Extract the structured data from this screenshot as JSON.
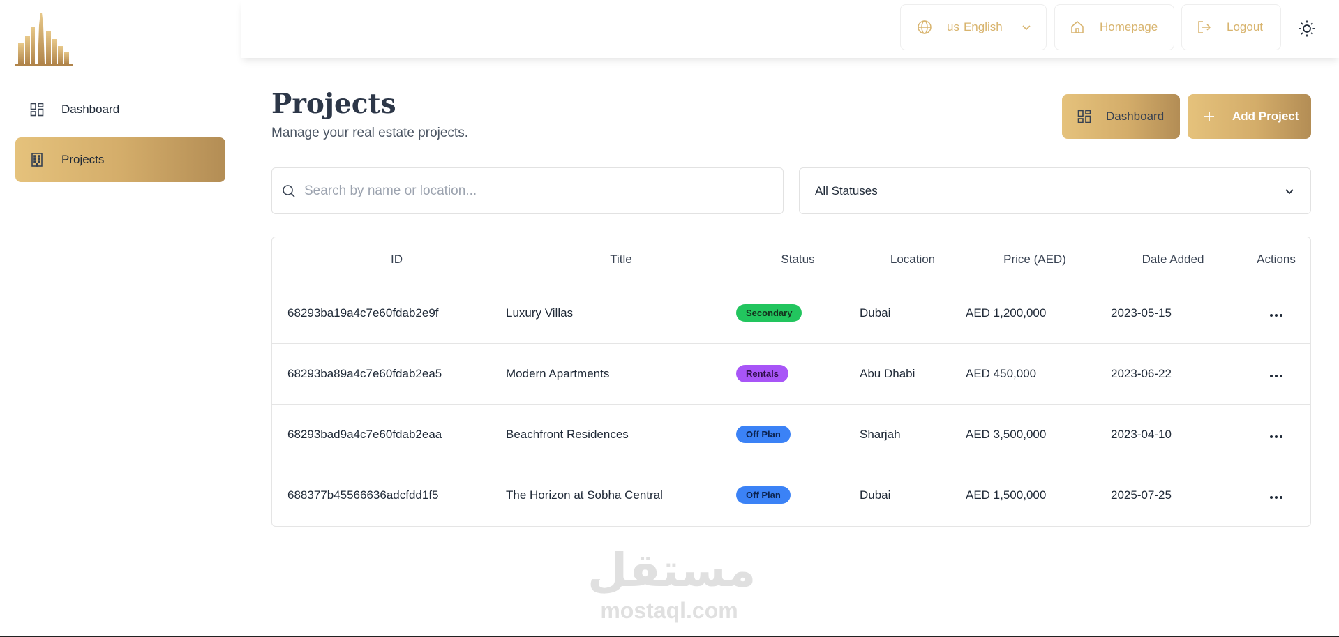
{
  "colors": {
    "gold_start": "#e5c27c",
    "gold_end": "#b38d55",
    "gold_text": "#d8b46e",
    "secondary_badge": "#22c55e",
    "rentals_badge": "#a855f7",
    "offplan_badge": "#3b82f6"
  },
  "sidebar": {
    "logo_icon": "city-skyline-logo",
    "items": [
      {
        "label": "Dashboard",
        "icon": "dashboard-grid-icon",
        "active": false
      },
      {
        "label": "Projects",
        "icon": "building-icon",
        "active": true
      }
    ]
  },
  "topbar": {
    "language": {
      "flag": "us",
      "label": "English",
      "icon": "globe-icon"
    },
    "homepage_label": "Homepage",
    "logout_label": "Logout",
    "theme_icon": "sun-icon"
  },
  "main": {
    "title": "Projects",
    "subtitle": "Manage your real estate projects.",
    "dashboard_button": "Dashboard",
    "add_project_button": "Add Project",
    "search": {
      "placeholder": "Search by name or location...",
      "value": ""
    },
    "status_filter": {
      "selected": "All Statuses"
    }
  },
  "table": {
    "headers": {
      "id": "ID",
      "title": "Title",
      "status": "Status",
      "location": "Location",
      "price": "Price (AED)",
      "date": "Date Added",
      "actions": "Actions"
    },
    "rows": [
      {
        "id": "68293ba19a4c7e60fdab2e9f",
        "title": "Luxury Villas",
        "status": "Secondary",
        "location": "Dubai",
        "price": "AED 1,200,000",
        "date": "2023-05-15"
      },
      {
        "id": "68293ba89a4c7e60fdab2ea5",
        "title": "Modern Apartments",
        "status": "Rentals",
        "location": "Abu Dhabi",
        "price": "AED 450,000",
        "date": "2023-06-22"
      },
      {
        "id": "68293bad9a4c7e60fdab2eaa",
        "title": "Beachfront Residences",
        "status": "Off Plan",
        "location": "Sharjah",
        "price": "AED 3,500,000",
        "date": "2023-04-10"
      },
      {
        "id": "688377b45566636adcfdd1f5",
        "title": "The Horizon at Sobha Central",
        "status": "Off Plan",
        "location": "Dubai",
        "price": "AED 1,500,000",
        "date": "2025-07-25"
      }
    ]
  },
  "watermark": {
    "arabic": "مستقل",
    "latin": "mostaql.com"
  }
}
